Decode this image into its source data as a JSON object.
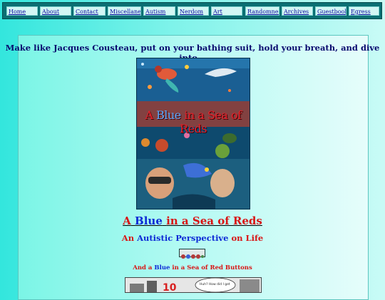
{
  "nav": {
    "items": [
      {
        "label": "Home"
      },
      {
        "label": "About"
      },
      {
        "label": "Contact"
      },
      {
        "label": "Miscellaneous"
      },
      {
        "label": "Autism"
      },
      {
        "label": "Nerdom"
      },
      {
        "label": "Art"
      },
      {
        "label": "Randomness"
      },
      {
        "label": "Archives"
      },
      {
        "label": "Guestbook"
      },
      {
        "label": "Egress"
      }
    ]
  },
  "headline": "Make like Jacques Cousteau, put on your bathing suit, hold your breath, and dive into...",
  "cover": {
    "title_a": "A ",
    "title_blue": "Blue",
    "title_rest": " in a Sea of Reds"
  },
  "title": {
    "a": "A",
    "blue": "Blue",
    "rest": "in a Sea of Reds"
  },
  "subtitle": {
    "an": "An",
    "autistic": "Autistic Perspective",
    "on_life": "on Life"
  },
  "buttons_caption": {
    "and_a": "And a",
    "blue": "Blue",
    "rest": "in a Sea of Red Buttons"
  },
  "comic": {
    "bubble_text": "Huh? How did I get"
  },
  "colors": {
    "nav_bar": "#0b6f73",
    "link": "#0a0a9e",
    "red": "#d91414",
    "blue": "#0d2ad6",
    "headline": "#08086e"
  }
}
